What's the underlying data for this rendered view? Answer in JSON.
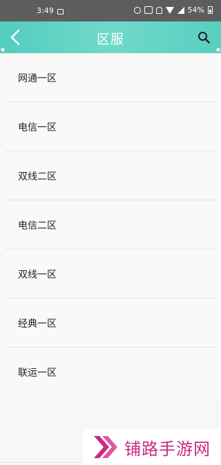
{
  "status_bar": {
    "time": "3:49",
    "battery": "54%",
    "network": "4G"
  },
  "app_bar": {
    "title": "区服"
  },
  "servers": [
    {
      "label": "网通一区"
    },
    {
      "label": "电信一区"
    },
    {
      "label": "双线二区"
    },
    {
      "label": "电信二区"
    },
    {
      "label": "双线一区"
    },
    {
      "label": "经典一区"
    },
    {
      "label": "联运一区"
    }
  ],
  "watermark": {
    "text": "铺路手游网"
  },
  "colors": {
    "app_bar": "#5ed2c3",
    "status_bar": "#5d5d5d",
    "watermark": "#c92a84"
  }
}
